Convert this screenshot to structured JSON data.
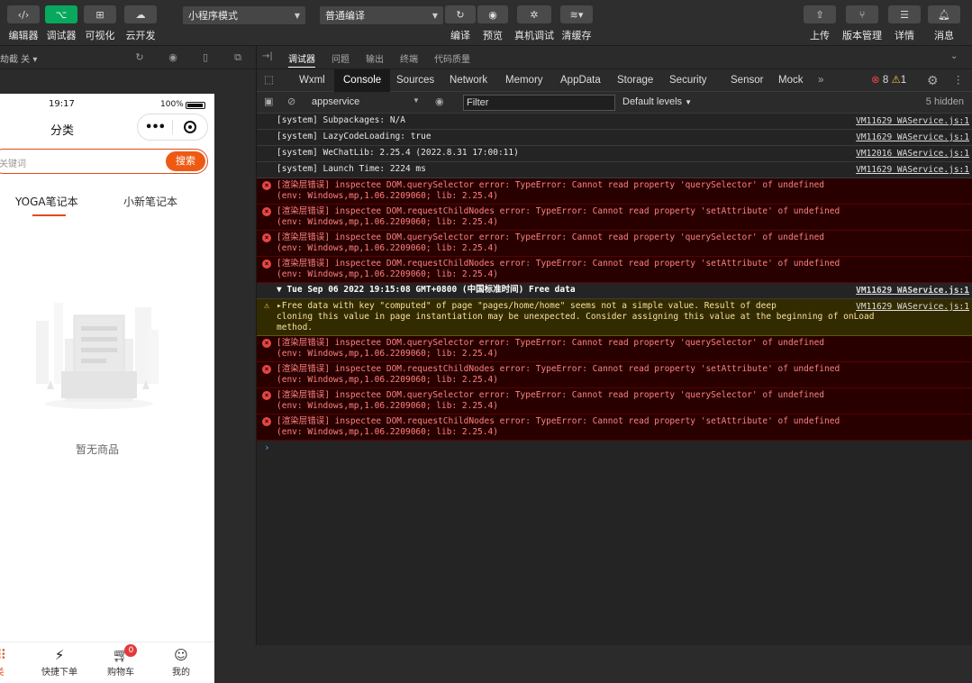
{
  "toolbar": {
    "left_buttons": [
      {
        "label": "编辑器",
        "icon": "code-icon"
      },
      {
        "label": "调试器",
        "icon": "debug-icon"
      },
      {
        "label": "可视化",
        "icon": "layout-icon"
      },
      {
        "label": "云开发",
        "icon": "cloud-icon"
      }
    ],
    "mode_select": "小程序模式",
    "compile_select": "普通编译",
    "center_buttons": [
      {
        "label": "编译",
        "icon": "refresh-icon"
      },
      {
        "label": "预览",
        "icon": "eye-icon"
      },
      {
        "label": "真机调试",
        "icon": "bug-icon"
      },
      {
        "label": "清缓存",
        "icon": "layers-icon"
      }
    ],
    "right_buttons": [
      {
        "label": "上传",
        "icon": "upload-icon"
      },
      {
        "label": "版本管理",
        "icon": "branch-icon"
      },
      {
        "label": "详情",
        "icon": "menu-icon"
      },
      {
        "label": "消息",
        "icon": "bell-icon"
      }
    ]
  },
  "simulator": {
    "bar_text": "劫截 关 ▾",
    "status_time": "19:17",
    "battery": "100%",
    "nav_title": "分类",
    "search_placeholder": "关键词",
    "search_button": "搜索",
    "tabs": [
      "YOGA笔记本",
      "小新笔记本"
    ],
    "empty_text": "暂无商品",
    "tabbar": [
      {
        "label": "分类",
        "icon": "grid-icon"
      },
      {
        "label": "快捷下单",
        "icon": "lightning-icon"
      },
      {
        "label": "购物车",
        "icon": "cart-icon",
        "badge": "0"
      },
      {
        "label": "我的",
        "icon": "user-icon"
      }
    ]
  },
  "devtools": {
    "top_tabs": [
      "调试器",
      "问题",
      "输出",
      "终端",
      "代码质量"
    ],
    "panel_tabs": [
      "Wxml",
      "Console",
      "Sources",
      "Network",
      "Memory",
      "AppData",
      "Storage",
      "Security",
      "Sensor",
      "Mock"
    ],
    "error_count": "8",
    "warning_count": "1",
    "context": "appservice",
    "filter": "Filter",
    "levels": "Default levels",
    "hidden": "5 hidden",
    "rows": [
      {
        "type": "log",
        "text": "[system] Subpackages: N/A",
        "text2": "",
        "src": "VM11629 WAService.js:1"
      },
      {
        "type": "log",
        "text": "[system] LazyCodeLoading: true",
        "text2": "",
        "src": "VM11629 WAService.js:1"
      },
      {
        "type": "log",
        "text": "[system] WeChatLib: 2.25.4 (2022.8.31 17:00:11)",
        "text2": "",
        "src": "VM12016 WAService.js:1"
      },
      {
        "type": "log",
        "text": "[system] Launch Time: 2224 ms",
        "text2": "",
        "src": "VM11629 WAService.js:1"
      },
      {
        "type": "err",
        "text": "[渲染层错误] inspectee DOM.querySelector error: TypeError: Cannot read property 'querySelector' of undefined",
        "text2": "(env: Windows,mp,1.06.2209060; lib: 2.25.4)",
        "src": ""
      },
      {
        "type": "err",
        "text": "[渲染层错误] inspectee DOM.requestChildNodes error: TypeError: Cannot read property 'setAttribute' of undefined",
        "text2": "(env: Windows,mp,1.06.2209060; lib: 2.25.4)",
        "src": ""
      },
      {
        "type": "err",
        "text": "[渲染层错误] inspectee DOM.querySelector error: TypeError: Cannot read property 'querySelector' of undefined",
        "text2": "(env: Windows,mp,1.06.2209060; lib: 2.25.4)",
        "src": ""
      },
      {
        "type": "err",
        "text": "[渲染层错误] inspectee DOM.requestChildNodes error: TypeError: Cannot read property 'setAttribute' of undefined",
        "text2": "(env: Windows,mp,1.06.2209060; lib: 2.25.4)",
        "src": ""
      },
      {
        "type": "group",
        "text": "▼ Tue Sep 06 2022 19:15:08 GMT+0800 (中国标准时间) Free data",
        "text2": "",
        "src": "VM11629 WAService.js:1"
      },
      {
        "type": "warn",
        "text": "▸Free data with key \"computed\" of page \"pages/home/home\" seems not a simple value. Result of deep",
        "text2": "cloning this value in page instantiation may be unexpected. Consider assigning this value at the beginning of onLoad method.",
        "src": "VM11629 WAService.js:1"
      },
      {
        "type": "err",
        "text": "[渲染层错误] inspectee DOM.querySelector error: TypeError: Cannot read property 'querySelector' of undefined",
        "text2": "(env: Windows,mp,1.06.2209060; lib: 2.25.4)",
        "src": ""
      },
      {
        "type": "err",
        "text": "[渲染层错误] inspectee DOM.requestChildNodes error: TypeError: Cannot read property 'setAttribute' of undefined",
        "text2": "(env: Windows,mp,1.06.2209060; lib: 2.25.4)",
        "src": ""
      },
      {
        "type": "err",
        "text": "[渲染层错误] inspectee DOM.querySelector error: TypeError: Cannot read property 'querySelector' of undefined",
        "text2": "(env: Windows,mp,1.06.2209060; lib: 2.25.4)",
        "src": ""
      },
      {
        "type": "err",
        "text": "[渲染层错误] inspectee DOM.requestChildNodes error: TypeError: Cannot read property 'setAttribute' of undefined",
        "text2": "(env: Windows,mp,1.06.2209060; lib: 2.25.4)",
        "src": ""
      }
    ]
  }
}
